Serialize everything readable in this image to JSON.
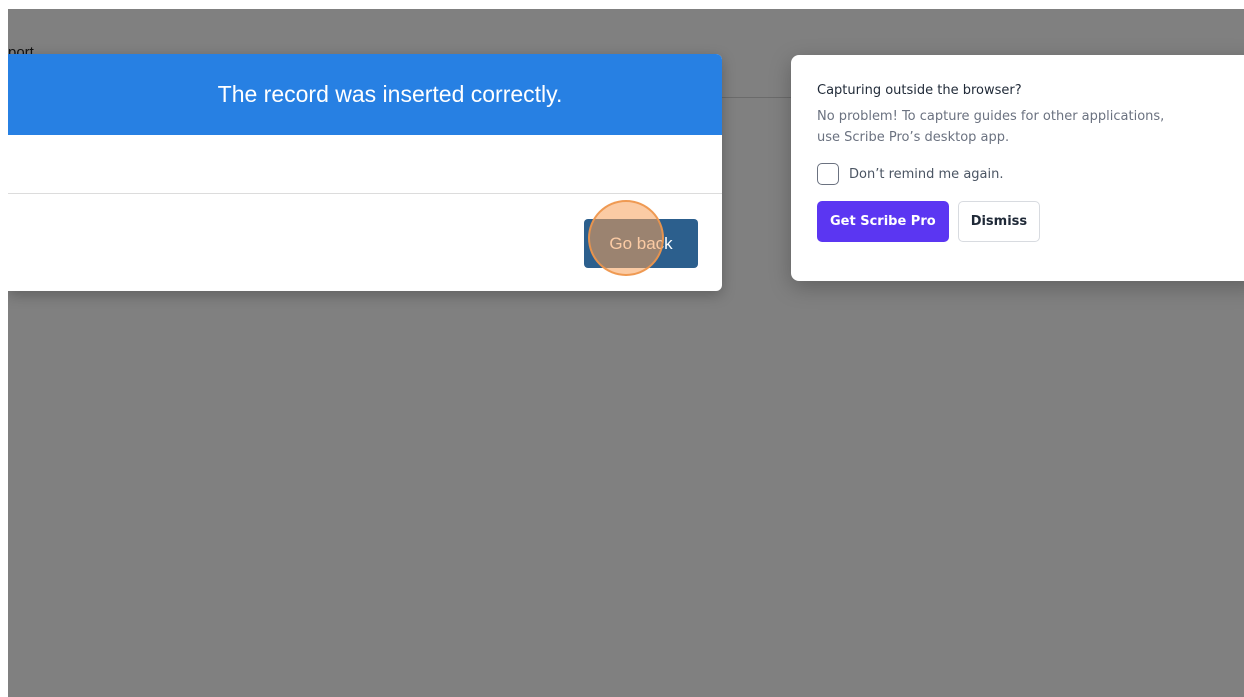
{
  "background": {
    "partial_text": "port"
  },
  "modal": {
    "title": "The record was inserted correctly.",
    "go_back_label": "Go back",
    "header_color": "#2780e3",
    "button_color": "#2c5f8d"
  },
  "popup": {
    "title": "Capturing outside the browser?",
    "description": "No problem! To capture guides for other applications, use Scribe Pro’s desktop app.",
    "checkbox_label": "Don’t remind me again.",
    "checkbox_checked": false,
    "primary_button": "Get Scribe Pro",
    "secondary_button": "Dismiss",
    "primary_color": "#5b36f2"
  },
  "overlay": {
    "click_indicator": "orange-click-ring"
  }
}
